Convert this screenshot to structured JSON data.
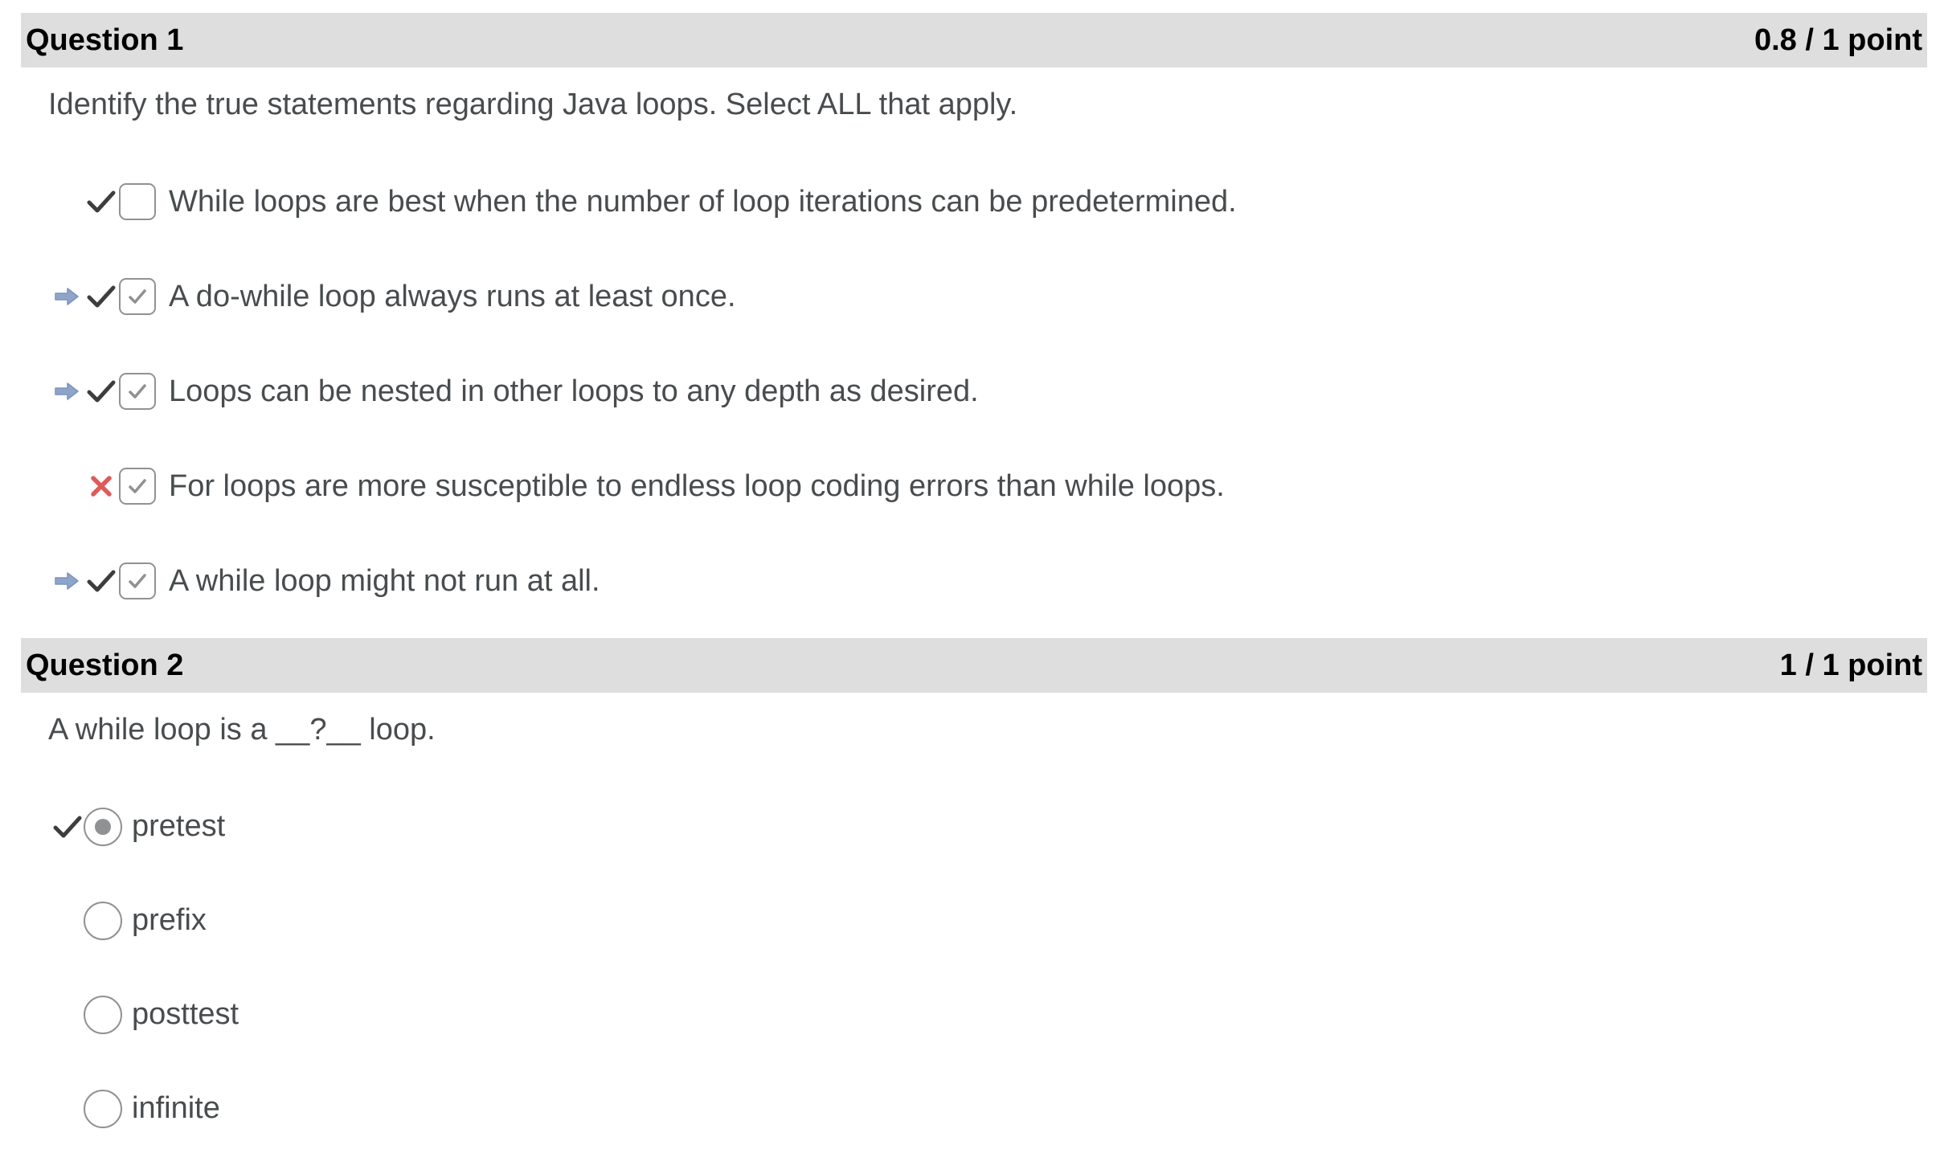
{
  "question1": {
    "title": "Question 1",
    "score": "0.8 / 1 point",
    "text": "Identify the true statements regarding Java loops. Select ALL that apply.",
    "options": [
      {
        "label": "While loops are best when the number of loop iterations can be predetermined.",
        "correct_answer": false,
        "selected": false,
        "result": "correct"
      },
      {
        "label": "A do-while loop always runs at least once.",
        "correct_answer": true,
        "selected": true,
        "result": "correct"
      },
      {
        "label": "Loops can be nested in other loops to any depth as desired.",
        "correct_answer": true,
        "selected": true,
        "result": "correct"
      },
      {
        "label": "For loops are more susceptible to endless loop coding errors than while loops.",
        "correct_answer": false,
        "selected": true,
        "result": "incorrect"
      },
      {
        "label": "A while loop might not run at all.",
        "correct_answer": true,
        "selected": true,
        "result": "correct"
      }
    ]
  },
  "question2": {
    "title": "Question 2",
    "score": "1 / 1 point",
    "text": "A while loop is a __?__ loop.",
    "options": [
      {
        "label": "pretest",
        "selected": true,
        "result": "correct"
      },
      {
        "label": "prefix",
        "selected": false,
        "result": "none"
      },
      {
        "label": "posttest",
        "selected": false,
        "result": "none"
      },
      {
        "label": "infinite",
        "selected": false,
        "result": "none"
      }
    ]
  },
  "icons": {
    "correct_answer_indicator": "arrow-right-icon",
    "correct_mark": "checkmark-icon",
    "incorrect_mark": "x-mark-icon",
    "colors": {
      "arrow": "#8fa5c8",
      "check": "#3d3d3d",
      "cross": "#e05a5a",
      "header_bg": "#dedede",
      "text": "#494c4e"
    }
  }
}
